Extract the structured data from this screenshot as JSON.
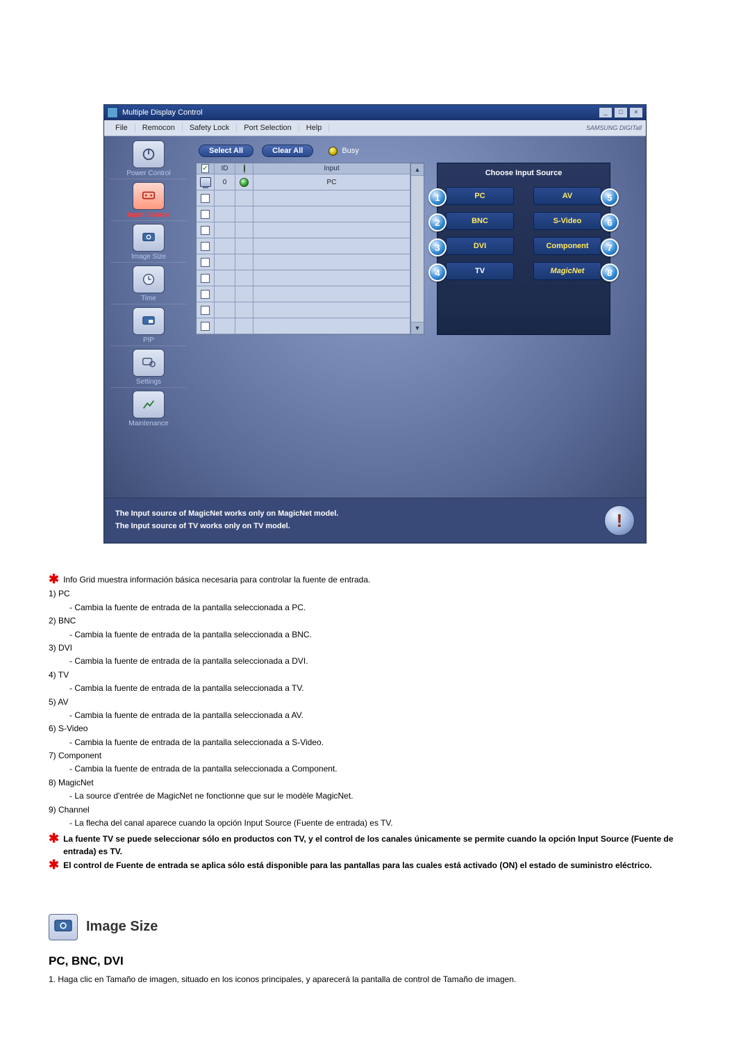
{
  "screenshot": {
    "title": "Multiple Display Control",
    "menu": {
      "file": "File",
      "remocon": "Remocon",
      "safety": "Safety Lock",
      "port": "Port Selection",
      "help": "Help"
    },
    "brand": "SAMSUNG DIGITall",
    "sidebar": {
      "power": "Power Control",
      "input": "Input Source",
      "image": "Image Size",
      "time": "Time",
      "pip": "PIP",
      "settings": "Settings",
      "maint": "Maintenance"
    },
    "toolbar": {
      "selectAll": "Select All",
      "clearAll": "Clear All",
      "busy": "Busy"
    },
    "grid": {
      "h_id": "ID",
      "h_input": "Input",
      "row0_id": "0",
      "row0_input": "PC"
    },
    "right": {
      "title": "Choose Input Source",
      "pc": "PC",
      "av": "AV",
      "bnc": "BNC",
      "svideo": "S-Video",
      "dvi": "DVI",
      "component": "Component",
      "tv": "TV",
      "magicnet": "MagicNet"
    },
    "footer": {
      "l1": "The Input source of MagicNet works only on MagicNet model.",
      "l2": "The Input source of TV works only on TV  model."
    }
  },
  "doc": {
    "intro": "Info Grid muestra información básica necesaria para controlar la fuente de entrada.",
    "i1h": "1)  PC",
    "i1b": "- Cambia la fuente de entrada de la pantalla seleccionada a PC.",
    "i2h": "2)  BNC",
    "i2b": "- Cambia la fuente de entrada de la pantalla seleccionada a BNC.",
    "i3h": "3)  DVI",
    "i3b": "- Cambia la fuente de entrada de la pantalla seleccionada a DVI.",
    "i4h": "4)  TV",
    "i4b": "- Cambia la fuente de entrada de la pantalla seleccionada a TV.",
    "i5h": "5)  AV",
    "i5b": "- Cambia la fuente de entrada de la pantalla seleccionada a AV.",
    "i6h": "6)  S-Video",
    "i6b": "- Cambia la fuente de entrada de la pantalla seleccionada a S-Video.",
    "i7h": "7)  Component",
    "i7b": "- Cambia la fuente de entrada de la pantalla seleccionada a Component.",
    "i8h": "8)  MagicNet",
    "i8b": "- La source d'entrée de MagicNet ne fonctionne que sur le modèle MagicNet.",
    "i9h": "9)  Channel",
    "i9b": "- La flecha del canal aparece cuando la opción Input Source (Fuente de entrada) es TV.",
    "note1": "La fuente TV se puede seleccionar sólo en productos con TV, y el control de los canales únicamente se permite cuando la opción Input Source (Fuente de entrada) es TV.",
    "note2": "El control de Fuente de entrada se aplica sólo está disponible para las pantallas para las cuales está activado (ON) el estado de suministro eléctrico.",
    "section": "Image Size",
    "sub": "PC, BNC, DVI",
    "step1": "1.  Haga clic en Tamaño de imagen, situado en los iconos principales, y aparecerá la pantalla de control de Tamaño de imagen."
  }
}
